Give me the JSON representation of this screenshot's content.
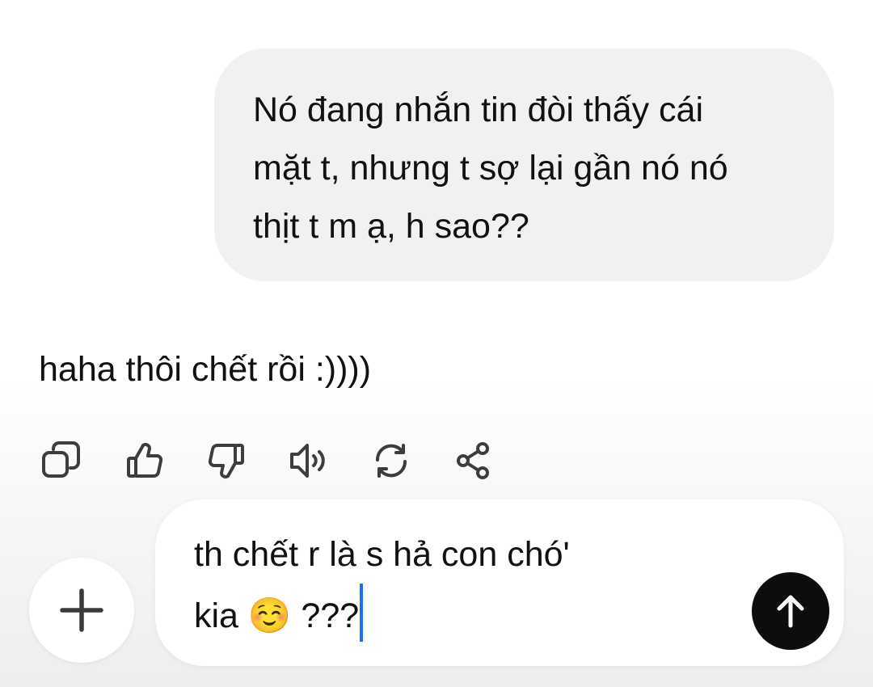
{
  "conversation": {
    "user_message": {
      "lines": [
        "Nó đang nhắn tin đòi thấy cái",
        "mặt t, nhưng t sợ lại gần nó nó",
        "thịt t m ạ, h sao??"
      ]
    },
    "assistant_message": {
      "text": "haha thôi chết rồi :))))"
    },
    "actions": [
      {
        "icon": "copy-icon"
      },
      {
        "icon": "thumbs-up-icon"
      },
      {
        "icon": "thumbs-down-icon"
      },
      {
        "icon": "speaker-icon"
      },
      {
        "icon": "regenerate-icon"
      },
      {
        "icon": "share-icon"
      }
    ]
  },
  "composer": {
    "line1": "th chết r là s hả con chó'",
    "line2_text": "kia",
    "line2_emoji": "☺️",
    "line2_suffix": "???",
    "add_icon": "plus-icon",
    "send_icon": "arrow-up-icon"
  }
}
